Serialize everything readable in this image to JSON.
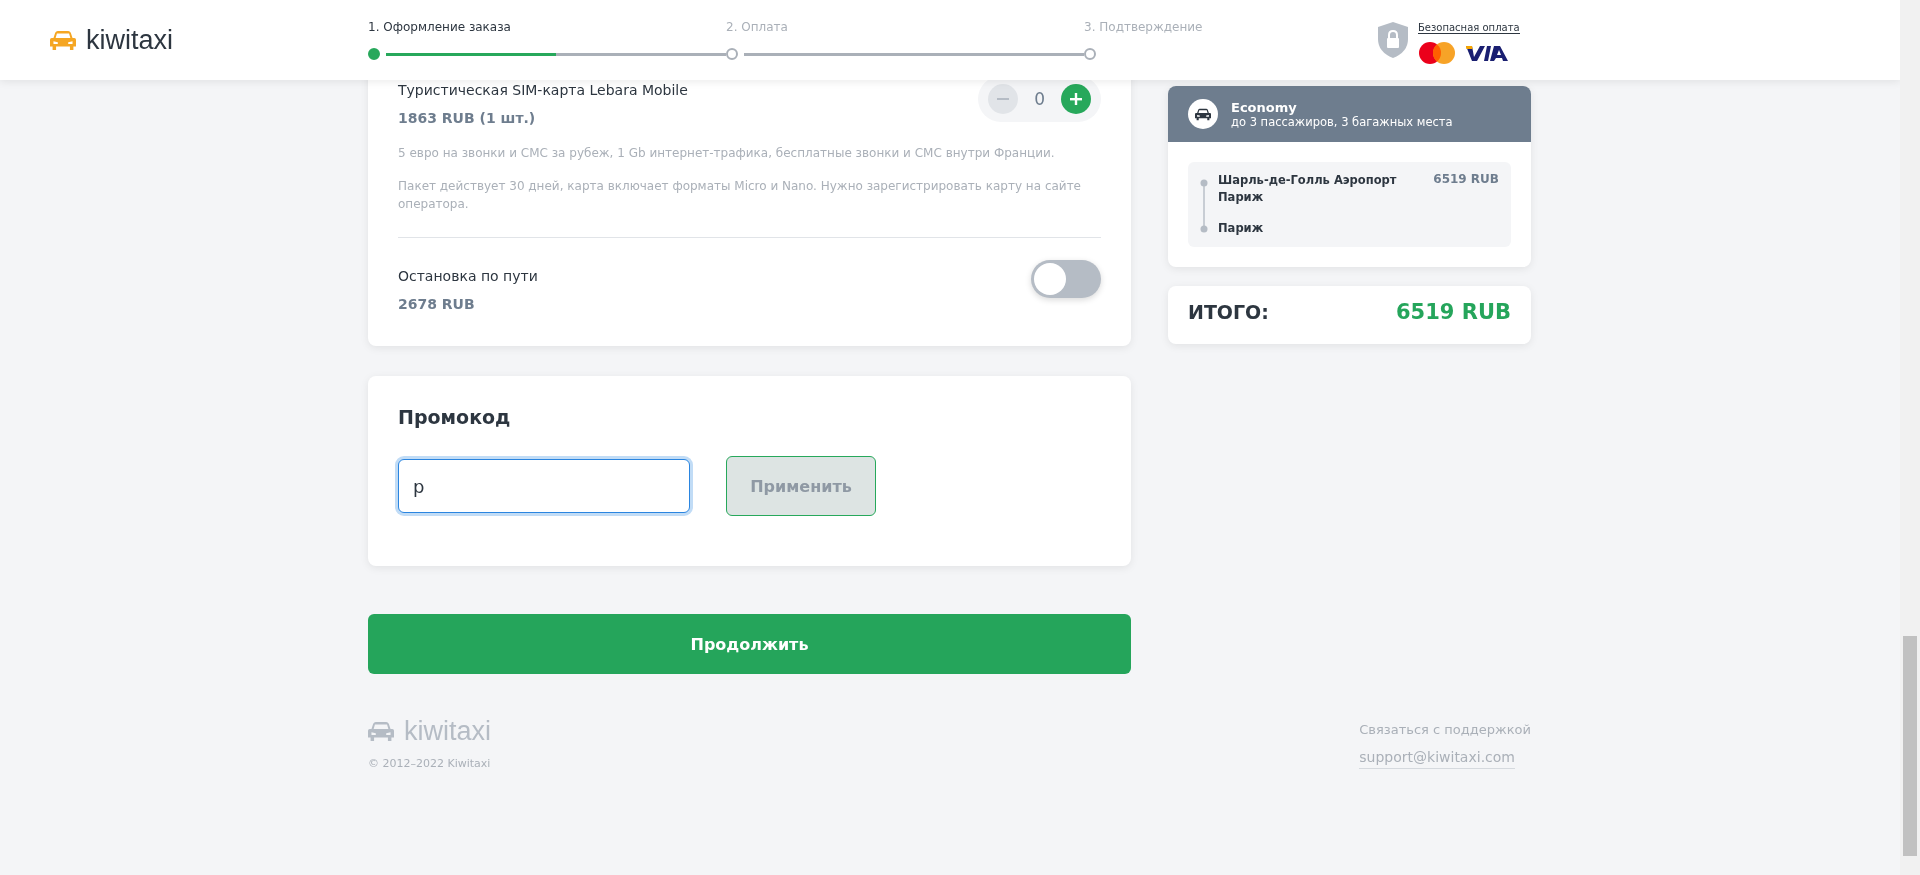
{
  "header": {
    "logo": "kiwitaxi",
    "steps": [
      {
        "label": "1. Оформление заказа",
        "selected": true,
        "level": 0.5
      },
      {
        "label": "2. Оплата",
        "selected": false,
        "level": 0
      },
      {
        "label": "3. Подтверждение",
        "selected": false
      }
    ],
    "secure_payment": "Безопасная оплата"
  },
  "extras": [
    {
      "kind": "stepper",
      "title": "Туристическая SIM-карта Lebara Mobile",
      "price": "1863 RUB (1 шт.)",
      "count": "0",
      "minus_disabled": true,
      "description": [
        "5 евро на звонки и СМС за рубеж, 1 Gb интернет-трафика, бесплатные звонки и СМС внутри Франции.",
        "Пакет действует 30 дней, карта включает форматы Micro и Nano. Нужно зарегистрировать карту на сайте оператора."
      ]
    },
    {
      "kind": "toggle",
      "title": "Остановка по пути",
      "price": "2678 RUB",
      "on": false
    }
  ],
  "promo": {
    "title": "Промокод",
    "value": "p",
    "button": "Применить",
    "button_disabled": true
  },
  "continue_button": "Продолжить",
  "summary": {
    "class": "Economy",
    "capacity": "до 3 пассажиров, 3 багажных места",
    "from": "Шарль-де-Голль Аэропорт Париж",
    "to": "Париж",
    "price": "6519 RUB"
  },
  "total": {
    "label": "ИТОГО:",
    "value": "6519 RUB"
  },
  "footer": {
    "logo": "kiwitaxi",
    "copyright": "© 2012–2022 Kiwitaxi",
    "contact": "Связаться с поддержкой",
    "email": "support@kiwitaxi.com"
  }
}
